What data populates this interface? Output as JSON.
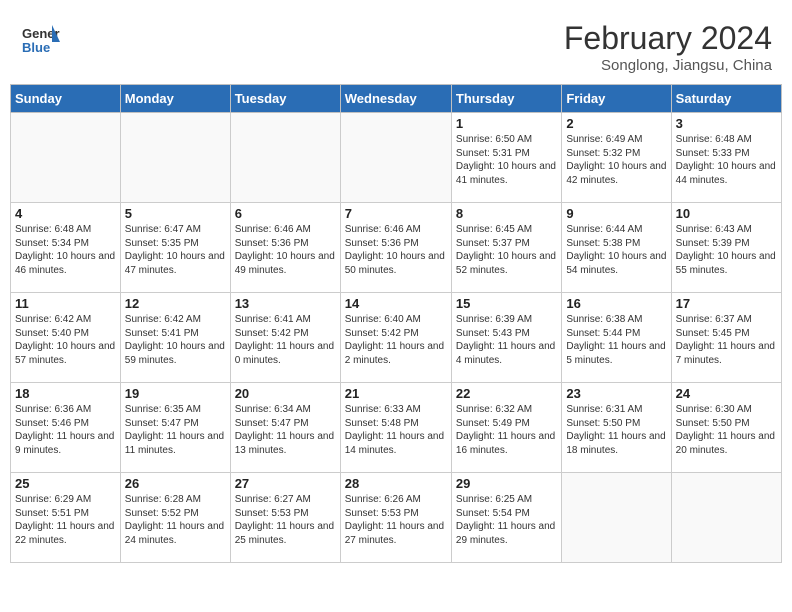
{
  "header": {
    "logo_general": "General",
    "logo_blue": "Blue",
    "month_year": "February 2024",
    "location": "Songlong, Jiangsu, China"
  },
  "days_of_week": [
    "Sunday",
    "Monday",
    "Tuesday",
    "Wednesday",
    "Thursday",
    "Friday",
    "Saturday"
  ],
  "weeks": [
    [
      {
        "day": "",
        "info": ""
      },
      {
        "day": "",
        "info": ""
      },
      {
        "day": "",
        "info": ""
      },
      {
        "day": "",
        "info": ""
      },
      {
        "day": "1",
        "info": "Sunrise: 6:50 AM\nSunset: 5:31 PM\nDaylight: 10 hours\nand 41 minutes."
      },
      {
        "day": "2",
        "info": "Sunrise: 6:49 AM\nSunset: 5:32 PM\nDaylight: 10 hours\nand 42 minutes."
      },
      {
        "day": "3",
        "info": "Sunrise: 6:48 AM\nSunset: 5:33 PM\nDaylight: 10 hours\nand 44 minutes."
      }
    ],
    [
      {
        "day": "4",
        "info": "Sunrise: 6:48 AM\nSunset: 5:34 PM\nDaylight: 10 hours\nand 46 minutes."
      },
      {
        "day": "5",
        "info": "Sunrise: 6:47 AM\nSunset: 5:35 PM\nDaylight: 10 hours\nand 47 minutes."
      },
      {
        "day": "6",
        "info": "Sunrise: 6:46 AM\nSunset: 5:36 PM\nDaylight: 10 hours\nand 49 minutes."
      },
      {
        "day": "7",
        "info": "Sunrise: 6:46 AM\nSunset: 5:36 PM\nDaylight: 10 hours\nand 50 minutes."
      },
      {
        "day": "8",
        "info": "Sunrise: 6:45 AM\nSunset: 5:37 PM\nDaylight: 10 hours\nand 52 minutes."
      },
      {
        "day": "9",
        "info": "Sunrise: 6:44 AM\nSunset: 5:38 PM\nDaylight: 10 hours\nand 54 minutes."
      },
      {
        "day": "10",
        "info": "Sunrise: 6:43 AM\nSunset: 5:39 PM\nDaylight: 10 hours\nand 55 minutes."
      }
    ],
    [
      {
        "day": "11",
        "info": "Sunrise: 6:42 AM\nSunset: 5:40 PM\nDaylight: 10 hours\nand 57 minutes."
      },
      {
        "day": "12",
        "info": "Sunrise: 6:42 AM\nSunset: 5:41 PM\nDaylight: 10 hours\nand 59 minutes."
      },
      {
        "day": "13",
        "info": "Sunrise: 6:41 AM\nSunset: 5:42 PM\nDaylight: 11 hours\nand 0 minutes."
      },
      {
        "day": "14",
        "info": "Sunrise: 6:40 AM\nSunset: 5:42 PM\nDaylight: 11 hours\nand 2 minutes."
      },
      {
        "day": "15",
        "info": "Sunrise: 6:39 AM\nSunset: 5:43 PM\nDaylight: 11 hours\nand 4 minutes."
      },
      {
        "day": "16",
        "info": "Sunrise: 6:38 AM\nSunset: 5:44 PM\nDaylight: 11 hours\nand 5 minutes."
      },
      {
        "day": "17",
        "info": "Sunrise: 6:37 AM\nSunset: 5:45 PM\nDaylight: 11 hours\nand 7 minutes."
      }
    ],
    [
      {
        "day": "18",
        "info": "Sunrise: 6:36 AM\nSunset: 5:46 PM\nDaylight: 11 hours\nand 9 minutes."
      },
      {
        "day": "19",
        "info": "Sunrise: 6:35 AM\nSunset: 5:47 PM\nDaylight: 11 hours\nand 11 minutes."
      },
      {
        "day": "20",
        "info": "Sunrise: 6:34 AM\nSunset: 5:47 PM\nDaylight: 11 hours\nand 13 minutes."
      },
      {
        "day": "21",
        "info": "Sunrise: 6:33 AM\nSunset: 5:48 PM\nDaylight: 11 hours\nand 14 minutes."
      },
      {
        "day": "22",
        "info": "Sunrise: 6:32 AM\nSunset: 5:49 PM\nDaylight: 11 hours\nand 16 minutes."
      },
      {
        "day": "23",
        "info": "Sunrise: 6:31 AM\nSunset: 5:50 PM\nDaylight: 11 hours\nand 18 minutes."
      },
      {
        "day": "24",
        "info": "Sunrise: 6:30 AM\nSunset: 5:50 PM\nDaylight: 11 hours\nand 20 minutes."
      }
    ],
    [
      {
        "day": "25",
        "info": "Sunrise: 6:29 AM\nSunset: 5:51 PM\nDaylight: 11 hours\nand 22 minutes."
      },
      {
        "day": "26",
        "info": "Sunrise: 6:28 AM\nSunset: 5:52 PM\nDaylight: 11 hours\nand 24 minutes."
      },
      {
        "day": "27",
        "info": "Sunrise: 6:27 AM\nSunset: 5:53 PM\nDaylight: 11 hours\nand 25 minutes."
      },
      {
        "day": "28",
        "info": "Sunrise: 6:26 AM\nSunset: 5:53 PM\nDaylight: 11 hours\nand 27 minutes."
      },
      {
        "day": "29",
        "info": "Sunrise: 6:25 AM\nSunset: 5:54 PM\nDaylight: 11 hours\nand 29 minutes."
      },
      {
        "day": "",
        "info": ""
      },
      {
        "day": "",
        "info": ""
      }
    ]
  ]
}
